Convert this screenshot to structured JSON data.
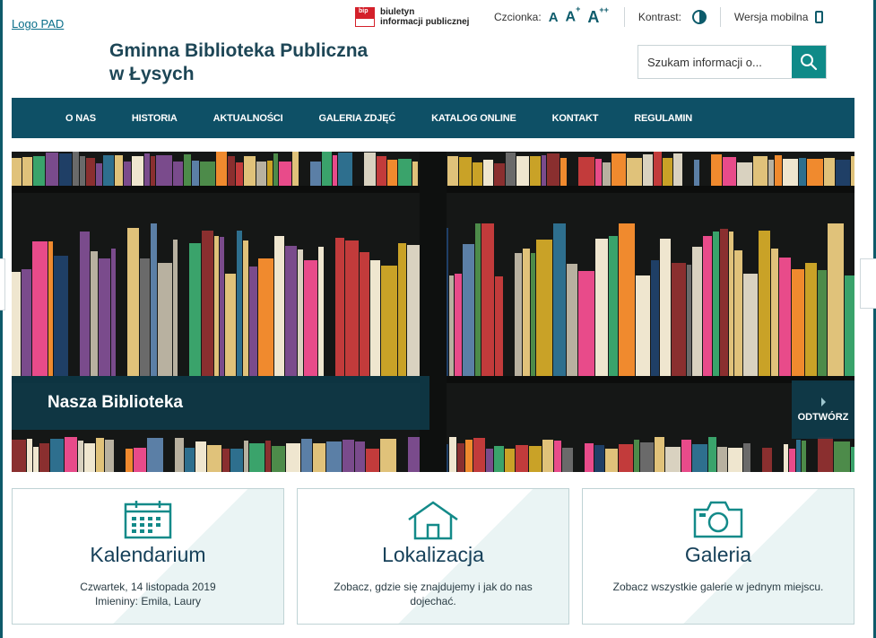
{
  "header": {
    "logo_link": "Logo PAD",
    "bip_line1": "biuletyn",
    "bip_line2": "informacji publicznej",
    "bip_mark": "bip",
    "font_label": "Czcionka:",
    "font_a": "A",
    "font_a_plus": "+",
    "font_a_plusplus": "++",
    "contrast_label": "Kontrast:",
    "mobile_label": "Wersja mobilna",
    "title_line1": "Gminna Biblioteka Publiczna",
    "title_line2": "w Łysych"
  },
  "search": {
    "placeholder": "Szukam informacji o..."
  },
  "nav": {
    "items": [
      "O NAS",
      "HISTORIA",
      "AKTUALNOŚCI",
      "GALERIA ZDJĘĆ",
      "KATALOG ONLINE",
      "KONTAKT",
      "REGULAMIN"
    ]
  },
  "hero": {
    "caption": "Nasza Biblioteka",
    "open_label": "ODTWÓRZ"
  },
  "cards": [
    {
      "title": "Kalendarium",
      "line1": "Czwartek, 14 listopada 2019",
      "line2": "Imieniny: Emila, Laury",
      "icon": "calendar-icon"
    },
    {
      "title": "Lokalizacja",
      "line1": "Zobacz, gdzie się znajdujemy i jak do nas",
      "line2": "dojechać.",
      "icon": "house-icon"
    },
    {
      "title": "Galeria",
      "line1": "Zobacz wszystkie galerie w jednym miejscu.",
      "line2": "",
      "icon": "camera-icon"
    }
  ],
  "colors": {
    "primary": "#0e5066",
    "accent": "#0f8a88",
    "title": "#1d4656"
  }
}
